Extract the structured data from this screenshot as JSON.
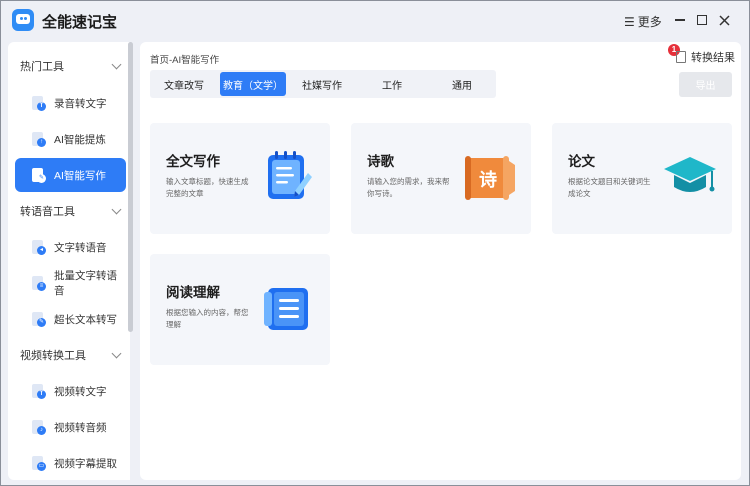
{
  "app": {
    "title": "全能速记宝"
  },
  "window": {
    "more_label": "更多",
    "menu_glyph": "☰"
  },
  "sidebar": {
    "groups": [
      {
        "title": "热门工具",
        "items": [
          {
            "label": "录音转文字",
            "icon_text": "T",
            "icon": "audio-doc-icon"
          },
          {
            "label": "AI智能提炼",
            "icon_text": "↑",
            "icon": "ai-extract-icon"
          },
          {
            "label": "AI智能写作",
            "icon_text": "✎",
            "icon": "ai-write-icon",
            "active": true
          }
        ]
      },
      {
        "title": "转语音工具",
        "items": [
          {
            "label": "文字转语音",
            "icon_text": "◂",
            "icon": "text-to-speech-icon"
          },
          {
            "label": "批量文字转语音",
            "icon_text": "≡",
            "icon": "batch-speech-icon"
          },
          {
            "label": "超长文本转写",
            "icon_text": "✎",
            "icon": "long-text-icon"
          }
        ]
      },
      {
        "title": "视频转换工具",
        "items": [
          {
            "label": "视频转文字",
            "icon_text": "T",
            "icon": "video-to-text-icon"
          },
          {
            "label": "视频转音频",
            "icon_text": "♪",
            "icon": "video-to-audio-icon"
          },
          {
            "label": "视频字幕提取",
            "icon_text": "▭",
            "icon": "subtitle-icon"
          }
        ]
      }
    ]
  },
  "main": {
    "breadcrumb": "首页-AI智能写作",
    "result": {
      "label": "转换结果",
      "badge": "1"
    },
    "export_label": "导出",
    "tabs": [
      {
        "label": "文章改写"
      },
      {
        "label": "教育（文学）",
        "active": true
      },
      {
        "label": "社媒写作"
      },
      {
        "label": "工作"
      },
      {
        "label": "通用"
      }
    ],
    "cards": [
      {
        "title": "全文写作",
        "desc": "输入文章标题，快速生成完整的文章",
        "icon": "notepad-pen-icon"
      },
      {
        "title": "诗歌",
        "desc": "请输入您的需求，我来帮你写诗。",
        "icon": "poem-scroll-icon",
        "glyph": "诗"
      },
      {
        "title": "论文",
        "desc": "根据论文题目和关键词生成论文",
        "icon": "graduation-cap-icon"
      },
      {
        "title": "阅读理解",
        "desc": "根据您输入的内容，帮您理解",
        "icon": "document-book-icon"
      }
    ]
  },
  "colors": {
    "accent": "#2e7cf6",
    "badge": "#e6303a",
    "poem_orange": "#f08a3c",
    "cap_teal": "#1fb7c9"
  }
}
